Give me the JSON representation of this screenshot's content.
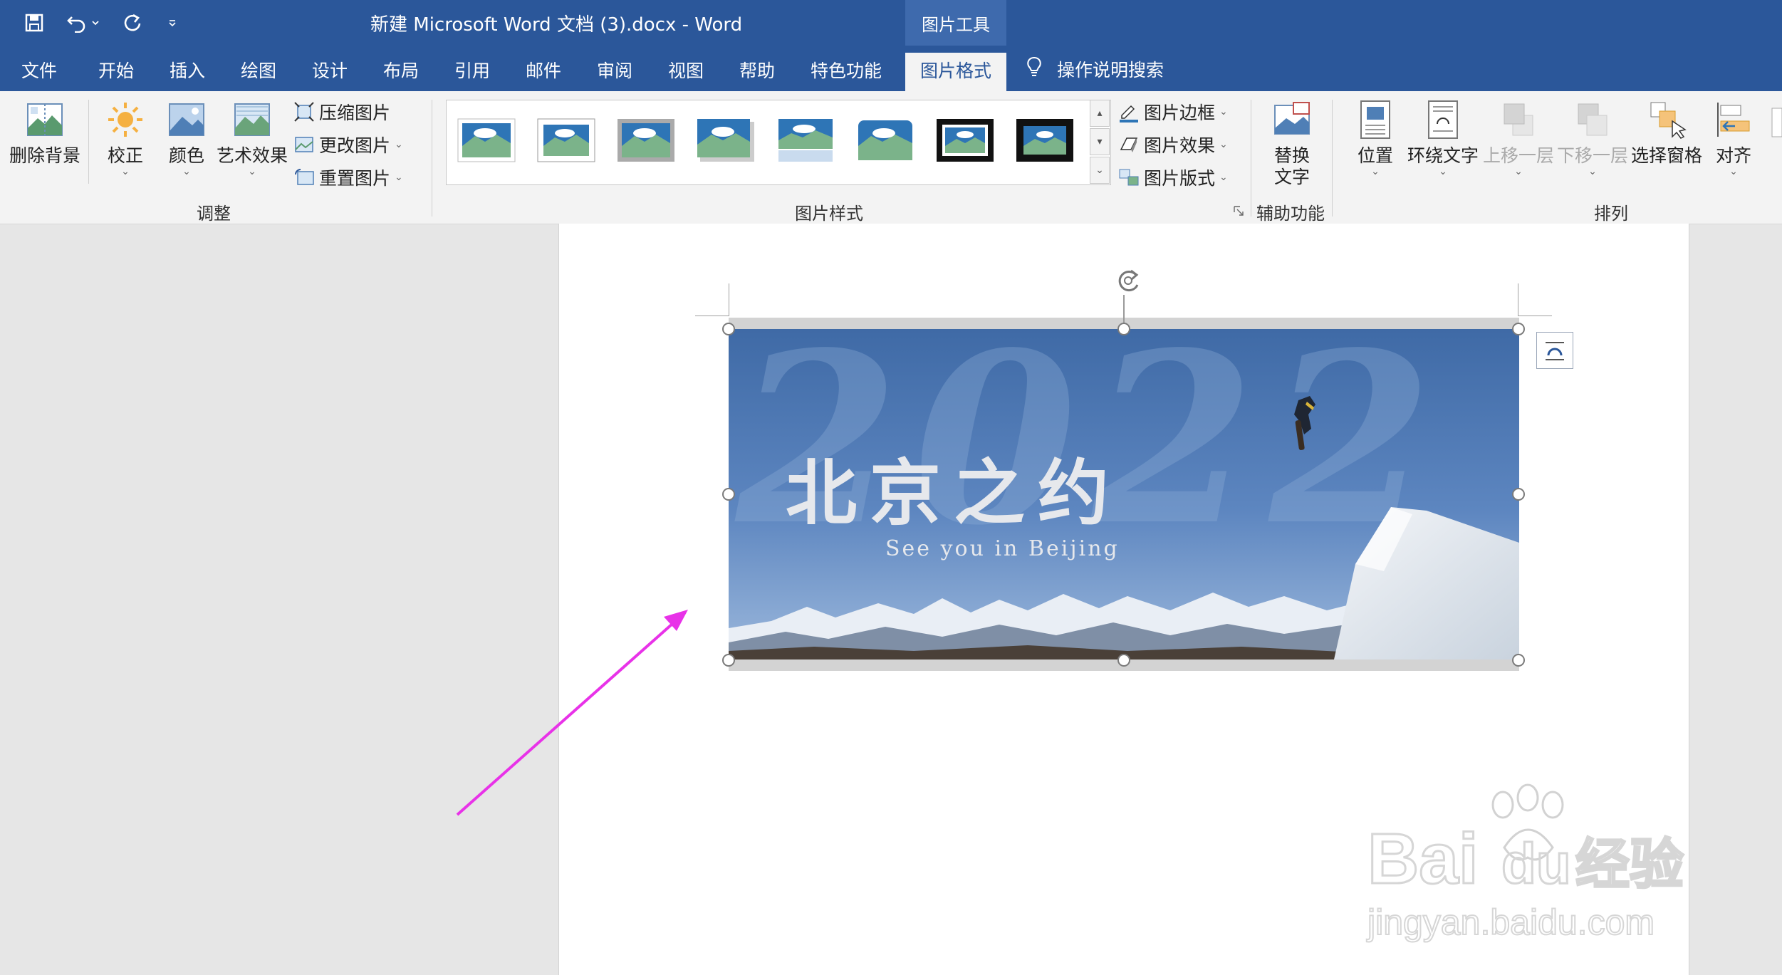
{
  "window": {
    "title": "新建 Microsoft Word 文档 (3).docx  -  Word",
    "context_header": "图片工具"
  },
  "tabs": [
    "文件",
    "开始",
    "插入",
    "绘图",
    "设计",
    "布局",
    "引用",
    "邮件",
    "审阅",
    "视图",
    "帮助",
    "特色功能",
    "图片格式"
  ],
  "active_tab": "图片格式",
  "tell_me": "操作说明搜索",
  "ribbon": {
    "adjust": {
      "remove_bg": "删除背景",
      "corrections": "校正",
      "color": "颜色",
      "artistic": "艺术效果",
      "compress": "压缩图片",
      "change": "更改图片",
      "reset": "重置图片",
      "label": "调整"
    },
    "styles": {
      "label": "图片样式",
      "border": "图片边框",
      "effects": "图片效果",
      "layout": "图片版式"
    },
    "accessibility": {
      "alt_text_line1": "替换",
      "alt_text_line2": "文字",
      "label": "辅助功能"
    },
    "arrange": {
      "position": "位置",
      "wrap": "环绕文字",
      "forward": "上移一层",
      "backward": "下移一层",
      "selection_pane": "选择窗格",
      "align": "对齐",
      "label": "排列"
    }
  },
  "picture": {
    "calligraphy": "北京之约",
    "subtitle": "See you in Beijing",
    "big_year": "2022"
  },
  "watermark": {
    "brand": "Bai",
    "brand2": "du",
    "cn": "经验",
    "url": "jingyan.baidu.com"
  },
  "colors": {
    "word_blue": "#2b579a",
    "ribbon_bg": "#f3f3f3",
    "arrow": "#e832e8"
  }
}
